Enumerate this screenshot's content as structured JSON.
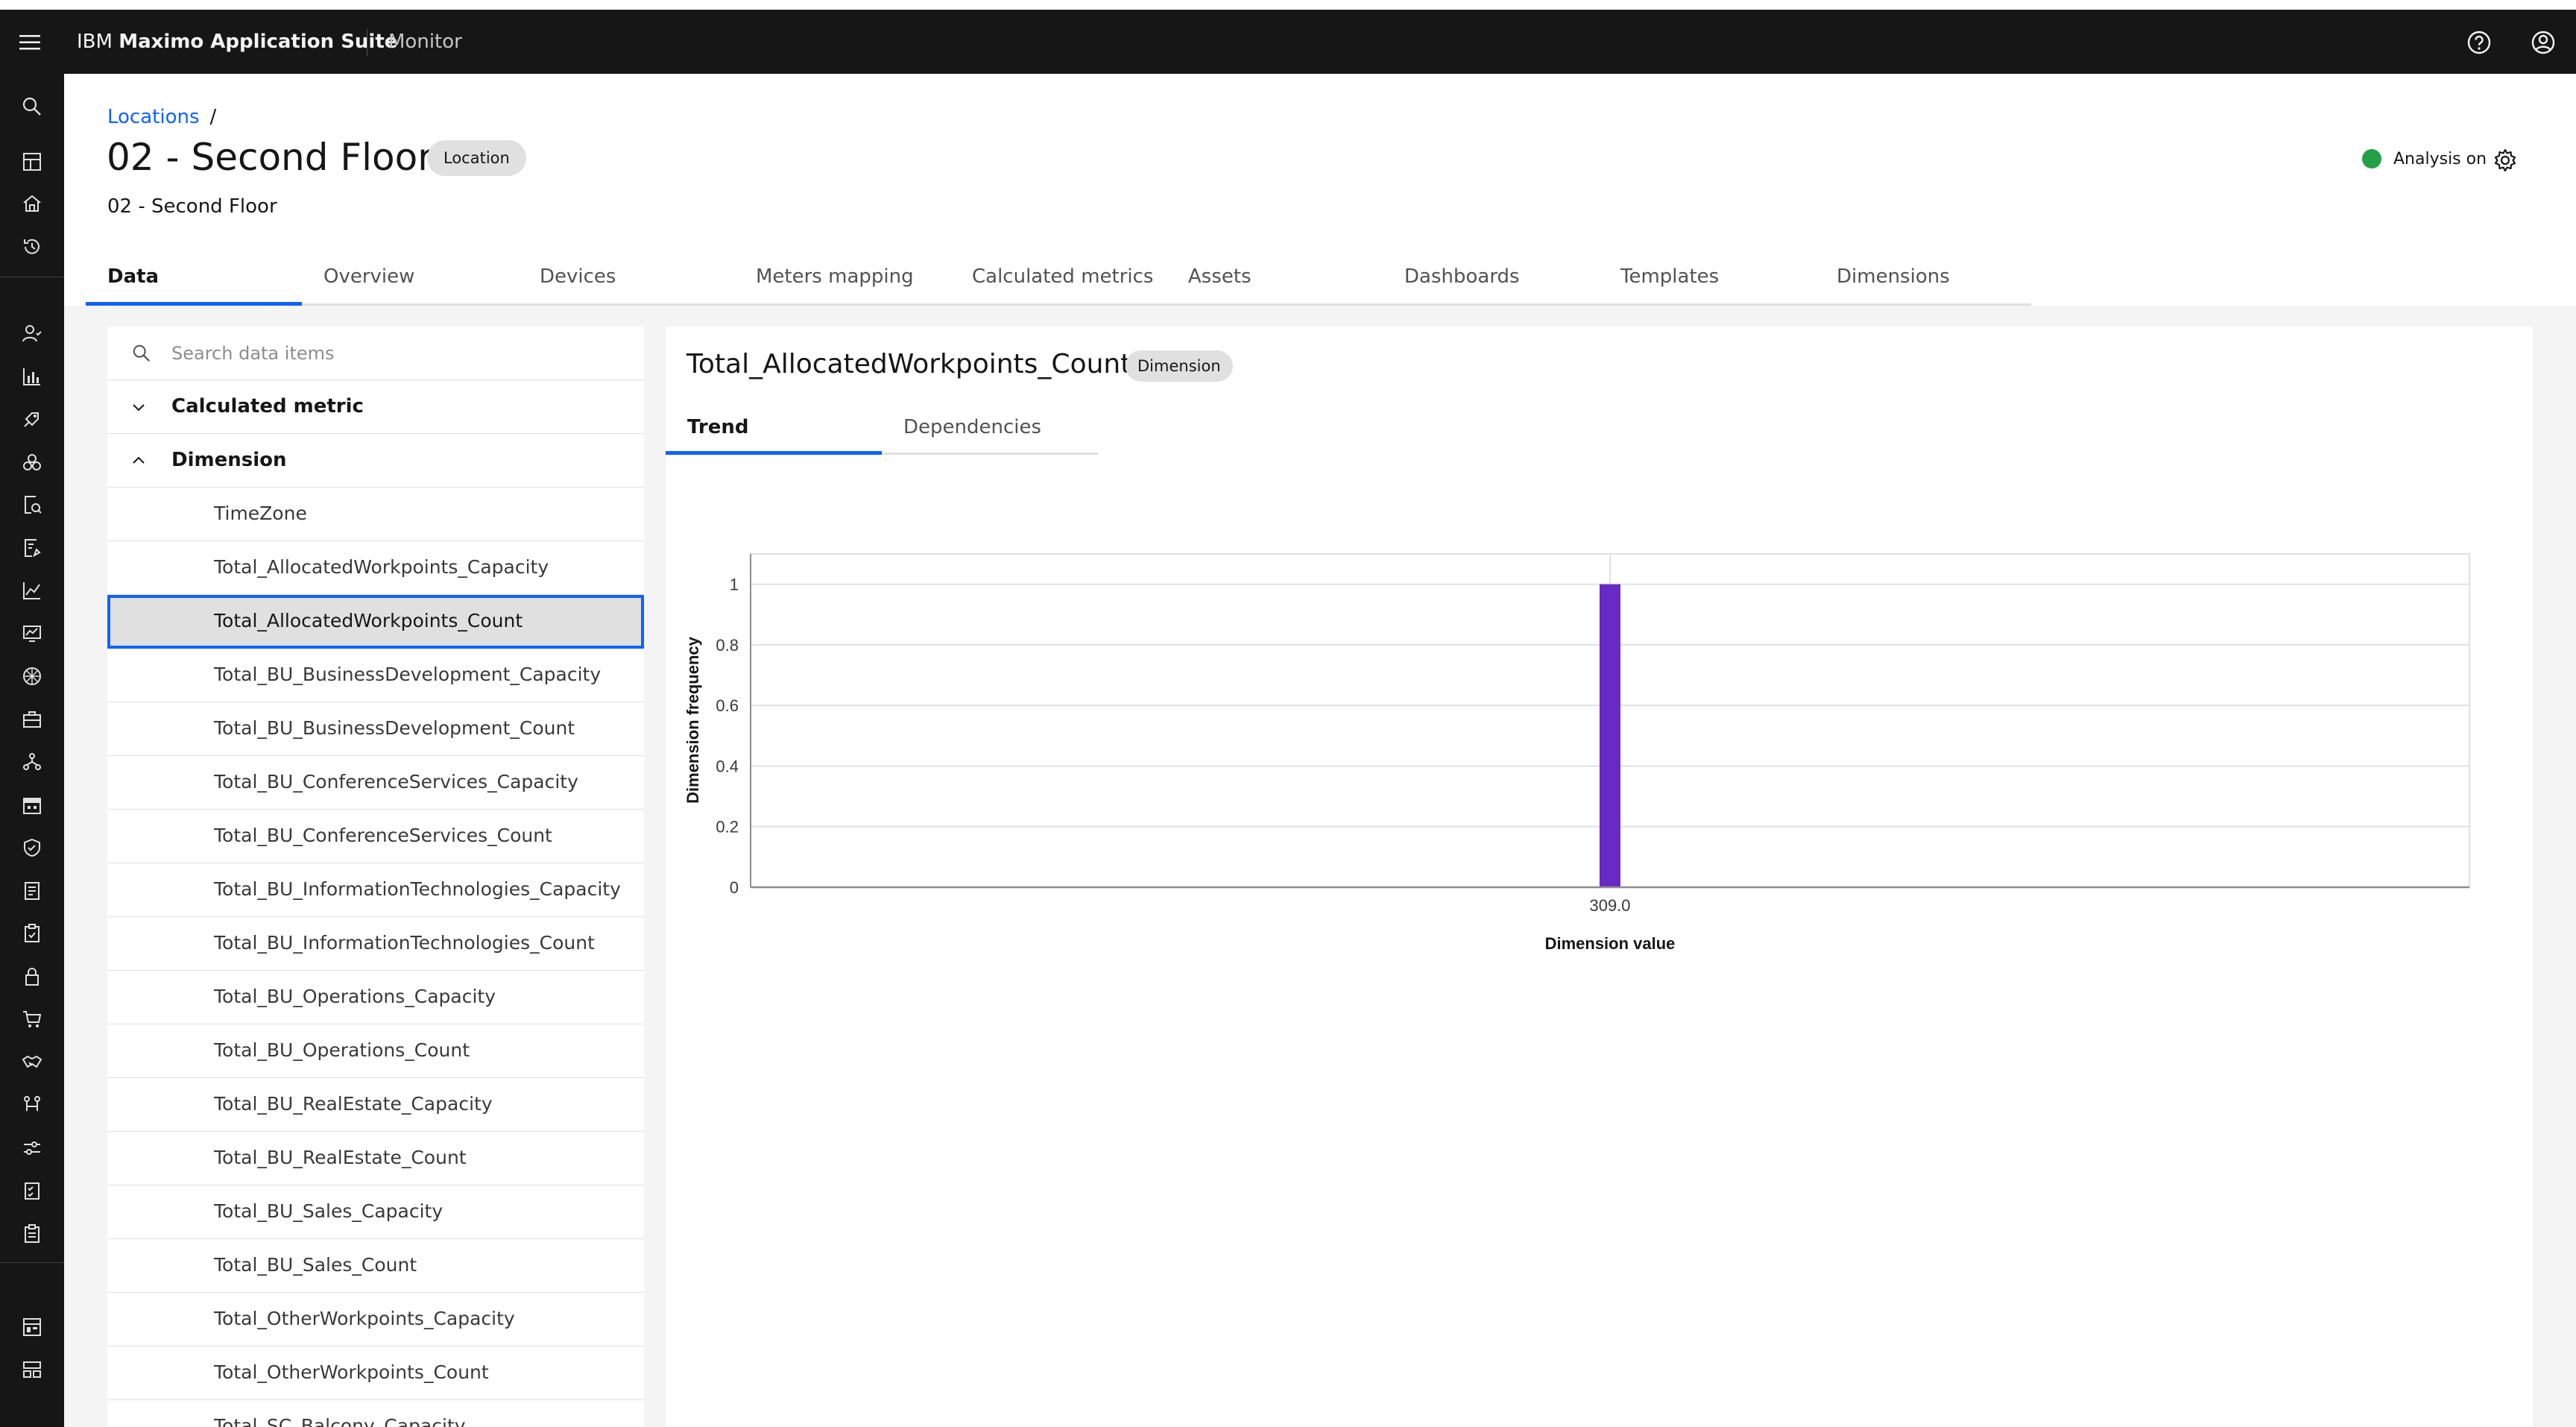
{
  "header": {
    "brand_prefix": "IBM",
    "brand_name": "Maximo Application Suite",
    "product": "Monitor",
    "icons": [
      "menu-icon",
      "help-icon",
      "user-avatar-icon"
    ]
  },
  "rail": {
    "icons": [
      "search-icon",
      "dashboard-icon",
      "home-icon",
      "recent-icon",
      "person-icon",
      "analytics-icon",
      "predict-icon",
      "asset-icon",
      "inspection-icon",
      "report-icon",
      "chart-line-icon",
      "monitor-icon",
      "health-icon",
      "briefcase-icon",
      "network-icon",
      "calendar-icon",
      "shield-icon",
      "document-icon",
      "clipboard-icon",
      "lock-icon",
      "cart-icon",
      "handshake-icon",
      "flow-icon",
      "settings-adjust-icon",
      "checklist-icon",
      "task-icon",
      "dashboard-grid-icon",
      "layout-icon"
    ]
  },
  "page": {
    "breadcrumb": "Locations",
    "breadcrumb_sep": "/",
    "title": "02 - Second Floor",
    "type_tag": "Location",
    "subtitle": "02 - Second Floor",
    "analysis_label": "Analysis on",
    "analysis_color": "#24a148"
  },
  "tabs": [
    "Data",
    "Overview",
    "Devices",
    "Meters mapping",
    "Calculated metrics",
    "Assets",
    "Dashboards",
    "Templates",
    "Dimensions"
  ],
  "active_tab": "Data",
  "list": {
    "search_placeholder": "Search data items",
    "group_calculated": "Calculated metric",
    "group_dimension": "Dimension",
    "items": [
      "TimeZone",
      "Total_AllocatedWorkpoints_Capacity",
      "Total_AllocatedWorkpoints_Count",
      "Total_BU_BusinessDevelopment_Capacity",
      "Total_BU_BusinessDevelopment_Count",
      "Total_BU_ConferenceServices_Capacity",
      "Total_BU_ConferenceServices_Count",
      "Total_BU_InformationTechnologies_Capacity",
      "Total_BU_InformationTechnologies_Count",
      "Total_BU_Operations_Capacity",
      "Total_BU_Operations_Count",
      "Total_BU_RealEstate_Capacity",
      "Total_BU_RealEstate_Count",
      "Total_BU_Sales_Capacity",
      "Total_BU_Sales_Count",
      "Total_OtherWorkpoints_Capacity",
      "Total_OtherWorkpoints_Count",
      "Total_SC_Balcony_Capacity"
    ],
    "selected_index": 2
  },
  "detail": {
    "title": "Total_AllocatedWorkpoints_Count",
    "tag": "Dimension",
    "subtabs": [
      "Trend",
      "Dependencies"
    ],
    "active_subtab": "Trend"
  },
  "chart_data": {
    "type": "bar",
    "categories": [
      "309.0"
    ],
    "values": [
      1
    ],
    "xlabel": "Dimension value",
    "ylabel": "Dimension frequency",
    "ylim": [
      0,
      1.1
    ],
    "yticks": [
      0,
      0.2,
      0.4,
      0.6,
      0.8,
      1
    ],
    "grid": true,
    "bar_color": "#6929c4"
  }
}
